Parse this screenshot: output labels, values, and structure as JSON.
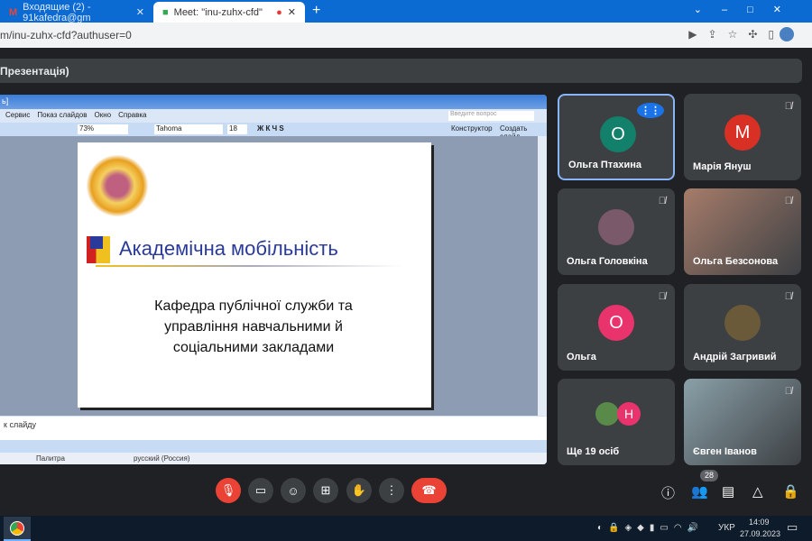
{
  "browser": {
    "tabs": [
      {
        "label": "Входящие (2) - 91kafedra@gm"
      },
      {
        "label": "Meet: \"inu-zuhx-cfd\""
      }
    ],
    "url": "m/inu-zuhx-cfd?authuser=0"
  },
  "meet": {
    "title": "Презентація)"
  },
  "ppt": {
    "title": "ь]",
    "menu": [
      "Сервис",
      "Показ слайдов",
      "Окно",
      "Справка"
    ],
    "question_placeholder": "Введите вопрос",
    "zoom": "73%",
    "font": "Tahoma",
    "size": "18",
    "designer": "Конструктор",
    "new_slide": "Создать слайд",
    "notes": "к слайду",
    "status": [
      "Палитра",
      "русский (Россия)"
    ],
    "slide": {
      "title": "Академічна мобільність",
      "body": "Кафедра публічної служби та управління навчальними й соціальними закладами"
    }
  },
  "participants": [
    {
      "name": "Ольга Птахина",
      "initial": "О",
      "color": "#12806b",
      "speaking": true
    },
    {
      "name": "Марія Януш",
      "initial": "М",
      "color": "#d93025"
    },
    {
      "name": "Ольга Головкіна",
      "initial": "",
      "color": "#7a5a6a"
    },
    {
      "name": "Ольга Безсонова",
      "initial": "",
      "color": "#a67c6a"
    },
    {
      "name": "Ольга",
      "initial": "О",
      "color": "#e8336d"
    },
    {
      "name": "Андрій Загривий",
      "initial": "",
      "color": "#6a5a3a"
    },
    {
      "name": "Ще 19 осіб",
      "initial": "Н",
      "color": "#e8336d"
    },
    {
      "name": "Євген Іванов",
      "initial": "",
      "color": "#8aa0a8"
    }
  ],
  "people_count": "28",
  "taskbar": {
    "lang": "УКР",
    "time": "14:09",
    "date": "27.09.2023"
  }
}
